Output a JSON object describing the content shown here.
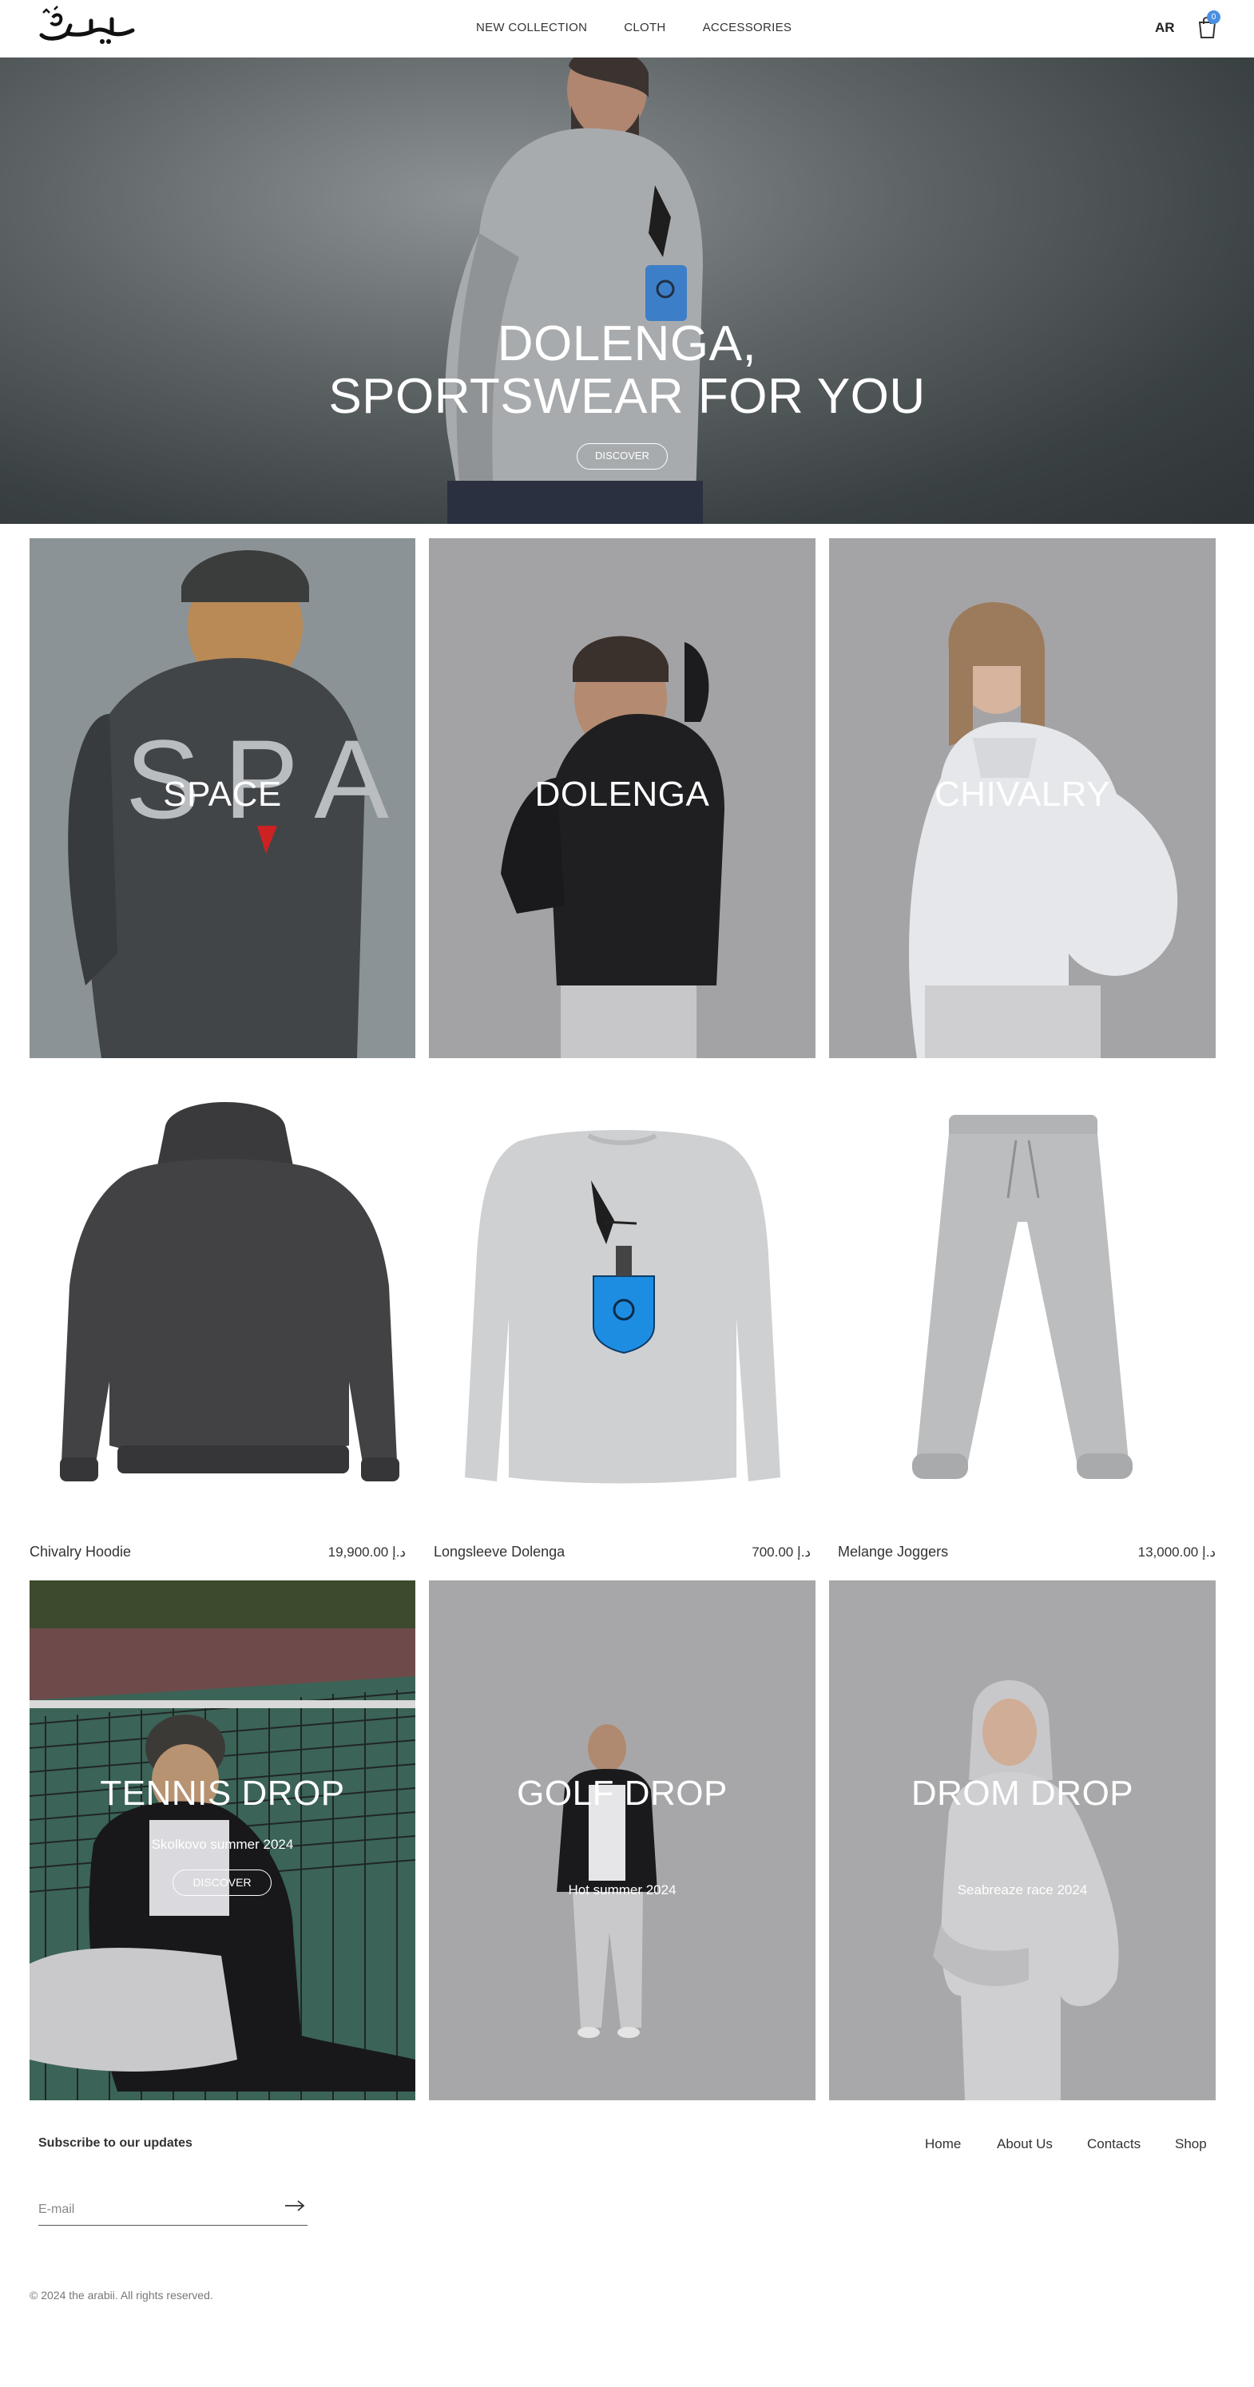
{
  "header": {
    "logo_text": "عــربي",
    "nav": [
      "NEW COLLECTION",
      "CLOTH",
      "ACCESSORIES"
    ],
    "lang": "AR",
    "cart_count": "0"
  },
  "hero": {
    "title_line1": "DOLENGA,",
    "title_line2": "SPORTSWEAR FOR YOU",
    "button": "DISCOVER"
  },
  "collections": [
    {
      "label": "SPACE"
    },
    {
      "label": "DOLENGA"
    },
    {
      "label": "CHIVALRY"
    }
  ],
  "products": [
    {
      "name": "Chivalry Hoodie",
      "price": "د.إ 19,900.00"
    },
    {
      "name": "Longsleeve Dolenga",
      "price": "د.إ 700.00"
    },
    {
      "name": "Melange Joggers",
      "price": "د.إ 13,000.00"
    }
  ],
  "drops": [
    {
      "title": "TENNIS DROP",
      "subtitle": "Skolkovo summer 2024",
      "button": "DISCOVER"
    },
    {
      "title": "GOLF DROP",
      "subtitle": "Hot summer 2024"
    },
    {
      "title": "DROM DROP",
      "subtitle": "Seabreaze race 2024"
    }
  ],
  "footer": {
    "subscribe_title": "Subscribe to our updates",
    "email_placeholder": "E-mail",
    "links": [
      "Home",
      "About Us",
      "Contacts",
      "Shop"
    ],
    "copyright": "© 2024 the arabii. All rights reserved."
  },
  "colors": {
    "accent": "#4a90e2",
    "hero_bg": "#3a4143",
    "tile_gray": "#a3a3a6"
  },
  "icons": [
    "cart-icon",
    "arrow-right-icon"
  ]
}
